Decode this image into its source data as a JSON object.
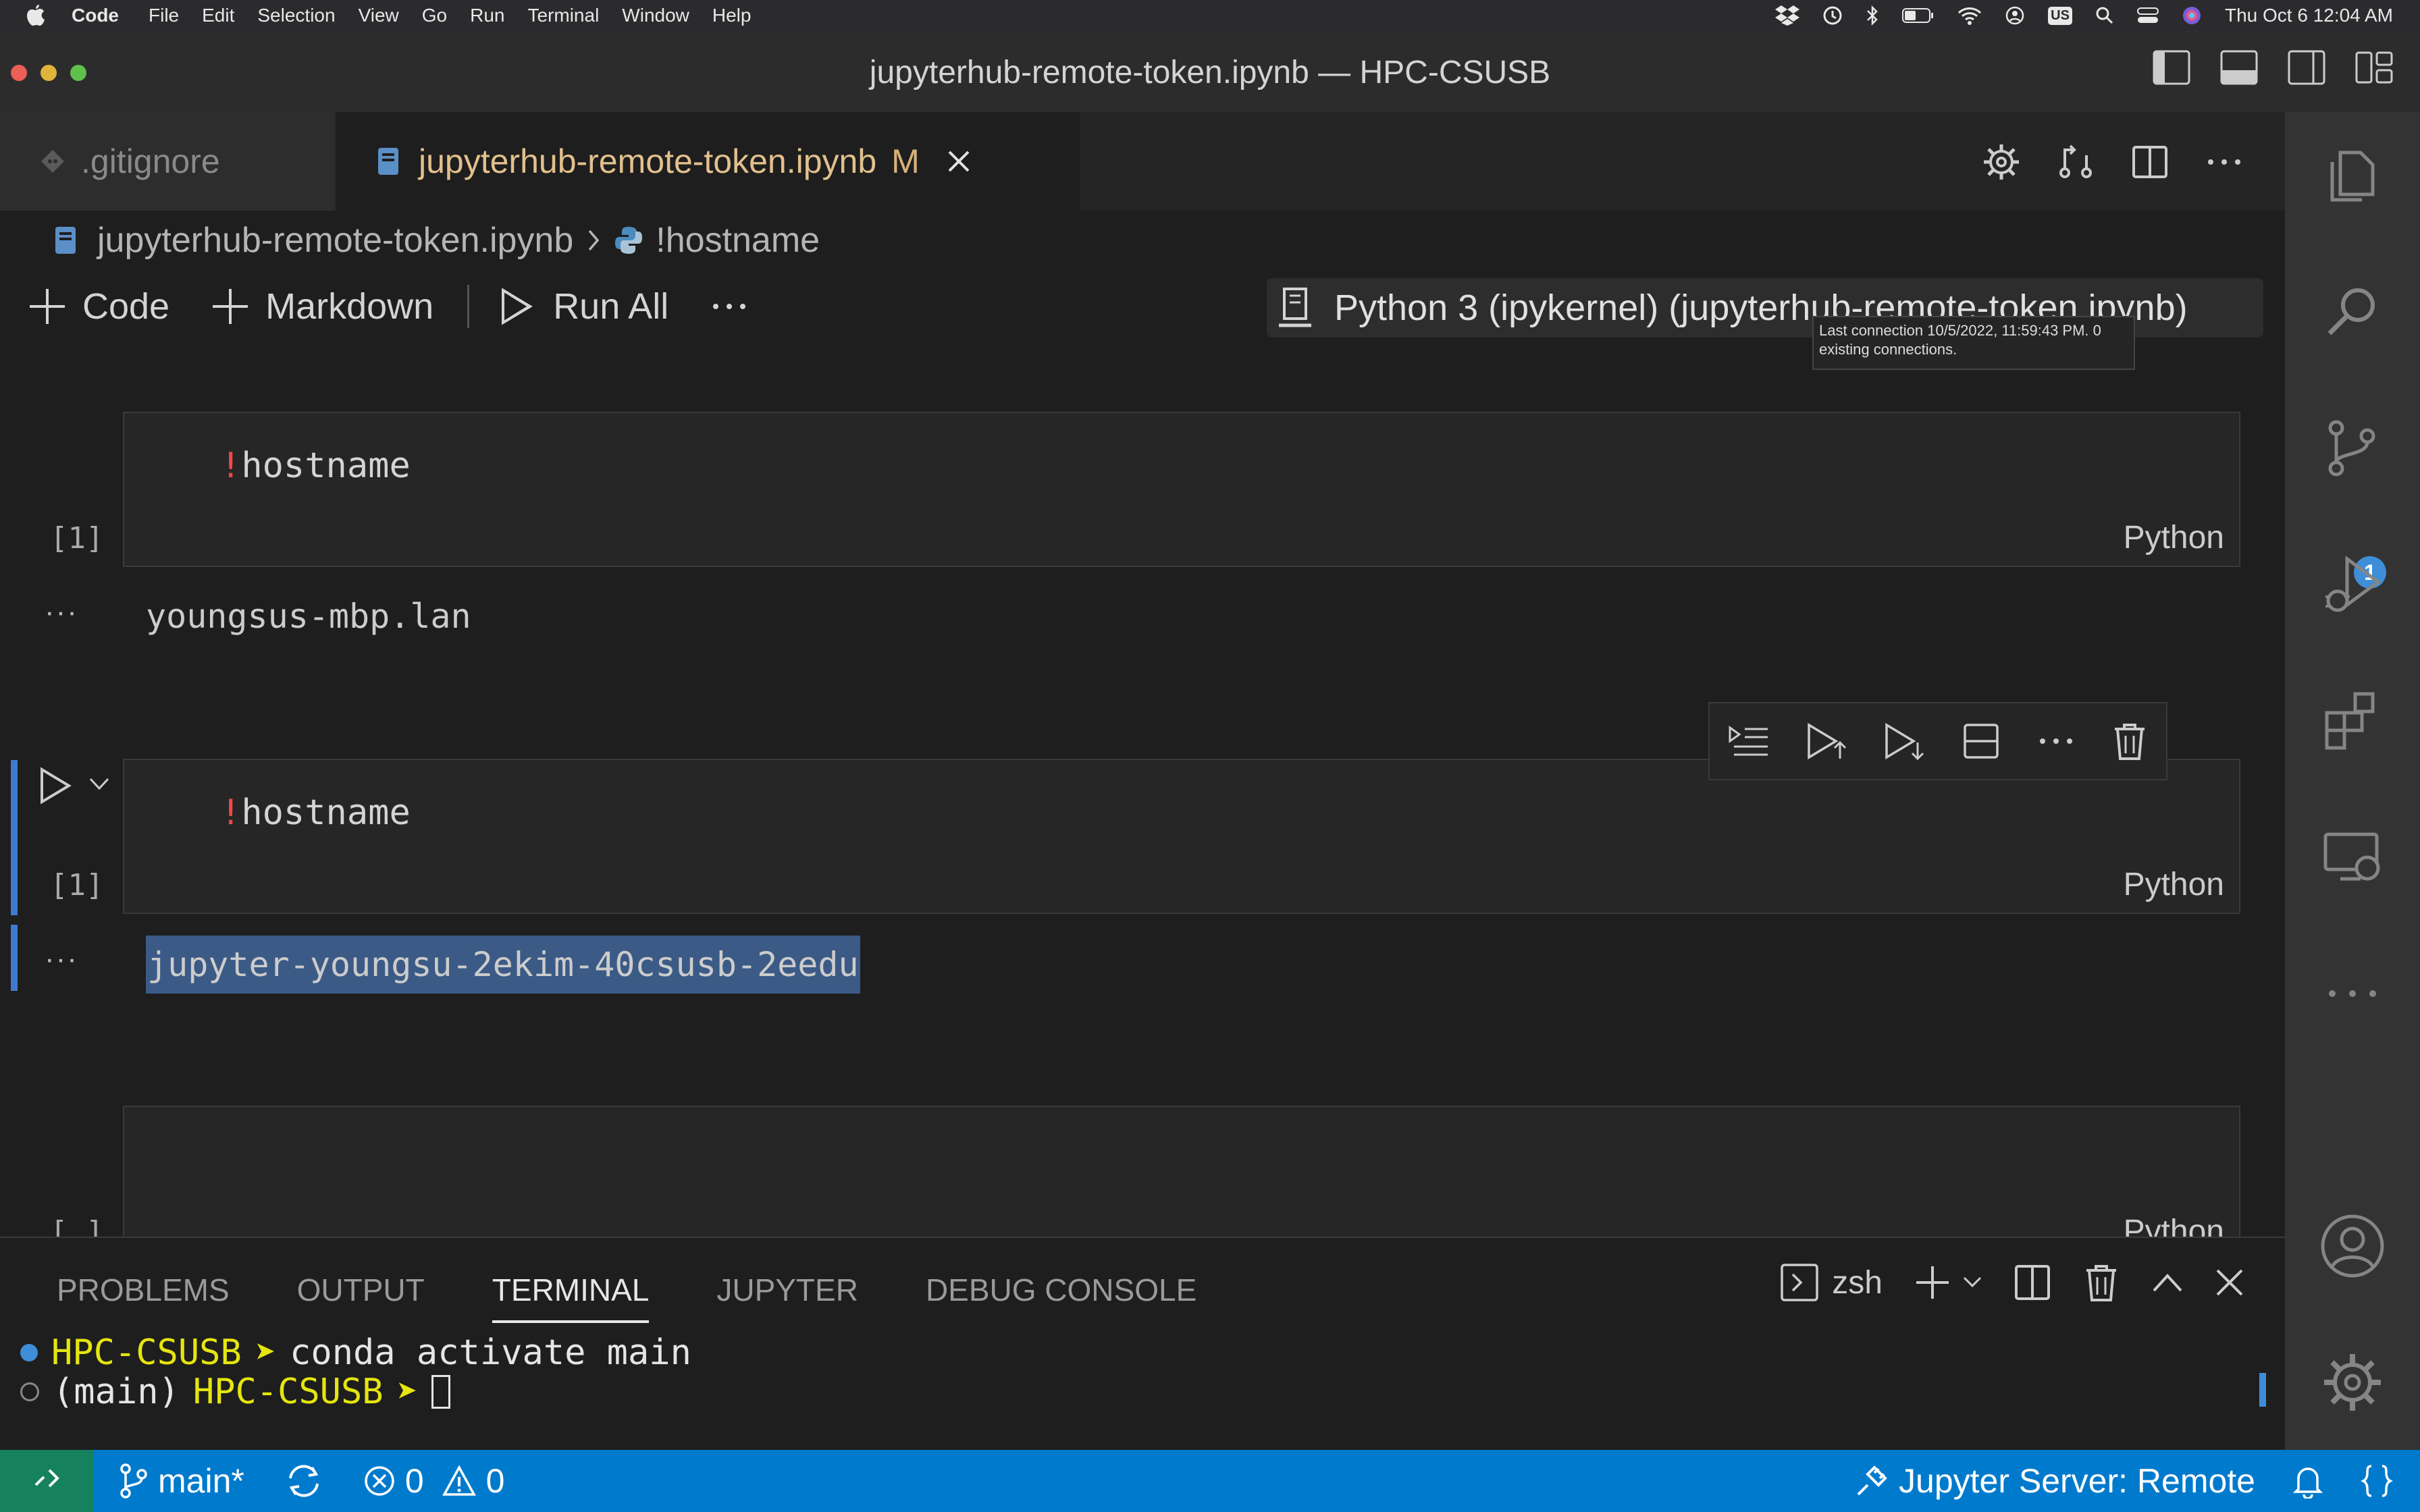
{
  "menubar": {
    "app_name": "Code",
    "items": [
      "File",
      "Edit",
      "Selection",
      "View",
      "Go",
      "Run",
      "Terminal",
      "Window",
      "Help"
    ],
    "input_source": "US",
    "datetime": "Thu Oct 6  12:04 AM"
  },
  "window": {
    "title": "jupyterhub-remote-token.ipynb — HPC-CSUSB"
  },
  "tabs": [
    {
      "label": ".gitignore",
      "active": false
    },
    {
      "label": "jupyterhub-remote-token.ipynb",
      "active": true,
      "modified": "M"
    }
  ],
  "breadcrumb": {
    "file": "jupyterhub-remote-token.ipynb",
    "symbol": "!hostname"
  },
  "notebook_toolbar": {
    "code_label": "Code",
    "markdown_label": "Markdown",
    "run_all_label": "Run All",
    "kernel_label": "Python 3 (ipykernel) (jupyterhub-remote-token.ipynb)",
    "tooltip": "Last connection 10/5/2022, 11:59:43 PM. 0 existing connections."
  },
  "cells": [
    {
      "bang": "!",
      "code": "hostname",
      "exec_count": "[1]",
      "language": "Python",
      "output": "youngsus-mbp.lan"
    },
    {
      "bang": "!",
      "code": "hostname",
      "exec_count": "[1]",
      "language": "Python",
      "output": "jupyter-youngsu-2ekim-40csusb-2eedu"
    },
    {
      "code": "",
      "exec_count": "[ ]",
      "language": "Python"
    }
  ],
  "output_dots": "···",
  "activity_badge": "1",
  "panel": {
    "tabs": [
      "PROBLEMS",
      "OUTPUT",
      "TERMINAL",
      "JUPYTER",
      "DEBUG CONSOLE"
    ],
    "active_tab": "TERMINAL",
    "shell": "zsh",
    "terminal_lines": [
      {
        "env": "",
        "host": "HPC-CSUSB",
        "prompt": "➤",
        "command": "conda activate main"
      },
      {
        "env": "(main)",
        "host": "HPC-CSUSB",
        "prompt": "➤",
        "command": ""
      }
    ]
  },
  "statusbar": {
    "branch": "main*",
    "errors": "0",
    "warnings": "0",
    "jupyter_server": "Jupyter Server: Remote"
  },
  "colors": {
    "status_bar": "#007acc",
    "remote_button": "#16825d",
    "modified_tab": "#e2c08d",
    "selection": "#3b5a86",
    "terminal_yellow": "#e5e510"
  }
}
